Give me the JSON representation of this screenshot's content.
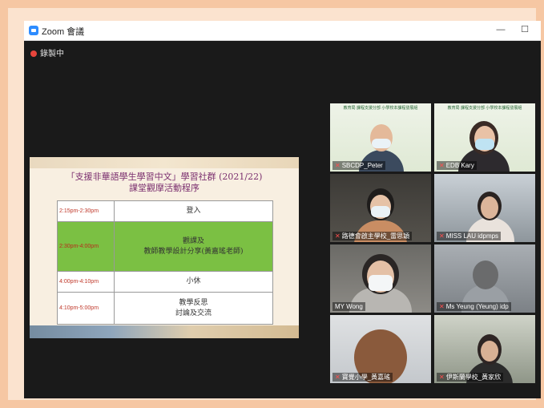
{
  "window": {
    "title": "Zoom 會議",
    "minimize_glyph": "—",
    "maximize_glyph": "☐"
  },
  "recording": {
    "label": "錄製中"
  },
  "slide": {
    "title_line1": "「支援非華語學生學習中文」學習社群 (2021/22)",
    "title_line2": "課堂觀摩活動程序",
    "rows": [
      {
        "time": "2:15pm-2:30pm",
        "activity_line1": "登入",
        "activity_line2": ""
      },
      {
        "time": "2:30pm-4:00pm",
        "activity_line1": "觀課及",
        "activity_line2": "教師教學設計分享(黃嘉瑤老師)"
      },
      {
        "time": "4:00pm-4:10pm",
        "activity_line1": "小休",
        "activity_line2": ""
      },
      {
        "time": "4:10pm-5:00pm",
        "activity_line1": "教學反思",
        "activity_line2": "討論及交流"
      }
    ]
  },
  "participants": [
    {
      "name": "SBCDP_Peter",
      "muted": true,
      "banner": "教育局 課程支援分部 小學校本課程發展組"
    },
    {
      "name": "EDB Kary",
      "muted": true,
      "banner": "教育局 課程支援分部 小學校本課程發展組"
    },
    {
      "name": "路德會啟主學校_雷思穎",
      "muted": true,
      "banner": ""
    },
    {
      "name": "MISS LAU idpmps",
      "muted": true,
      "banner": ""
    },
    {
      "name": "MY Wong",
      "muted": false,
      "banner": ""
    },
    {
      "name": "Ms Yeung (Yeung) idp",
      "muted": true,
      "banner": ""
    },
    {
      "name": "寶覺小學_黃嘉瑤",
      "muted": true,
      "banner": ""
    },
    {
      "name": "伊斯蘭學校_黃家欣",
      "muted": true,
      "banner": ""
    }
  ],
  "colors": {
    "accent": "#2d8cff",
    "active_speaker": "#d8e24a",
    "recording_dot": "#e8453c",
    "muted_icon": "#ff4d4d"
  }
}
